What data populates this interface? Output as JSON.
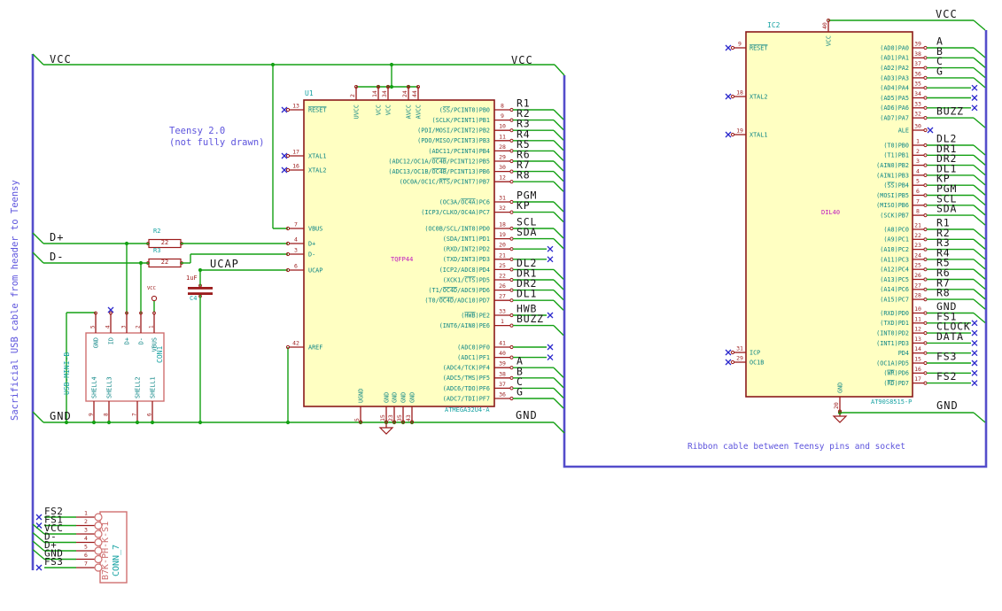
{
  "notes": {
    "left_cable": "Sacrificial USB cable from header to Teensy",
    "teensy_line1": "Teensy 2.0",
    "teensy_line2": "(not fully drawn)",
    "ribbon": "Ribbon cable between Teensy pins and socket"
  },
  "net_labels": {
    "vcc": "VCC",
    "gnd": "GND",
    "dplus": "D+",
    "dminus": "D-",
    "ucap": "UCAP"
  },
  "u1": {
    "ref": "U1",
    "package": "TQFP44",
    "value": "ATMEGA32U4-A",
    "top_pins": [
      {
        "num": "2",
        "name": "UVCC"
      },
      {
        "num": "14",
        "name": "VCC"
      },
      {
        "num": "34",
        "name": "VCC"
      },
      {
        "num": "24",
        "name": "AVCC"
      },
      {
        "num": "44",
        "name": "AVCC"
      }
    ],
    "bottom_pins": [
      {
        "num": "5",
        "name": "UGND"
      },
      {
        "num": "15",
        "name": "GND"
      },
      {
        "num": "23",
        "name": "GND"
      },
      {
        "num": "35",
        "name": "GND"
      },
      {
        "num": "43",
        "name": "GND"
      }
    ],
    "left_pins": [
      {
        "num": "13",
        "name": "*RESET*",
        "nc": true
      },
      {
        "num": "17",
        "name": "XTAL1",
        "nc": true
      },
      {
        "num": "16",
        "name": "XTAL2",
        "nc": true
      },
      {
        "num": "7",
        "name": "VBUS"
      },
      {
        "num": "4",
        "name": "D+"
      },
      {
        "num": "3",
        "name": "D-"
      },
      {
        "num": "6",
        "name": "UCAP"
      },
      {
        "num": "42",
        "name": "AREF"
      }
    ],
    "right_groups": [
      {
        "pins": [
          {
            "num": "8",
            "name": "(*SS*/PCINT0)PB0",
            "net": "R1"
          },
          {
            "num": "9",
            "name": "(SCLK/PCINT1)PB1",
            "net": "R2"
          },
          {
            "num": "10",
            "name": "(PDI/MOSI/PCINT2)PB2",
            "net": "R3"
          },
          {
            "num": "11",
            "name": "(PDO/MISO/PCINT3)PB3",
            "net": "R4"
          },
          {
            "num": "28",
            "name": "(ADC11/PCINT4)PB4",
            "net": "R5"
          },
          {
            "num": "29",
            "name": "(ADC12/OC1A/*OC4B*/PCINT12)PB5",
            "net": "R6"
          },
          {
            "num": "30",
            "name": "(ADC13/OC1B/*OC4B*/PCINT13)PB6",
            "net": "R7"
          },
          {
            "num": "12",
            "name": "(OC0A/OC1C/*RTS*/PCINT7)PB7",
            "net": "R8"
          }
        ]
      },
      {
        "pins": [
          {
            "num": "31",
            "name": "(OC3A/*OC4A*)PC6",
            "net": "PGM"
          },
          {
            "num": "32",
            "name": "(ICP3/CLKO/OC4A)PC7",
            "net": "KP"
          }
        ]
      },
      {
        "pins": [
          {
            "num": "18",
            "name": "(OC0B/SCL/INT0)PD0",
            "net": "SCL"
          },
          {
            "num": "19",
            "name": "(SDA/INT1)PD1",
            "net": "SDA"
          },
          {
            "num": "20",
            "name": "(RXD/INT2)PD2",
            "nc": true
          },
          {
            "num": "21",
            "name": "(TXD/INT3)PD3",
            "nc": true
          },
          {
            "num": "25",
            "name": "(ICP2/ADC8)PD4",
            "net": "DL2"
          },
          {
            "num": "22",
            "name": "(XCK1/*CTS*)PD5",
            "net": "DR1"
          },
          {
            "num": "26",
            "name": "(T1/*OC4D*/ADC9)PD6",
            "net": "DR2"
          },
          {
            "num": "27",
            "name": "(T0/*OC4D*/ADC10)PD7",
            "net": "DL1"
          }
        ]
      },
      {
        "pins": [
          {
            "num": "33",
            "name": "(*HWB*)PE2",
            "net": "HWB",
            "nc": true
          },
          {
            "num": "1",
            "name": "(INT6/AIN0)PE6",
            "net": "BUZZ"
          }
        ]
      },
      {
        "pins": [
          {
            "num": "41",
            "name": "(ADC0)PF0",
            "nc": true
          },
          {
            "num": "40",
            "name": "(ADC1)PF1",
            "nc": true
          },
          {
            "num": "39",
            "name": "(ADC4/TCK)PF4",
            "net": "A"
          },
          {
            "num": "38",
            "name": "(ADC5/TMS)PF5",
            "net": "B"
          },
          {
            "num": "37",
            "name": "(ADC6/TDO)PF6",
            "net": "C"
          },
          {
            "num": "36",
            "name": "(ADC7/TDI)PF7",
            "net": "G"
          }
        ]
      }
    ]
  },
  "ic2": {
    "ref": "IC2",
    "package": "DIL40",
    "value": "AT90S8515-P",
    "top_pin": {
      "num": "40",
      "name": "VCC"
    },
    "bottom_pin": {
      "num": "20",
      "name": "GND"
    },
    "left_pins": [
      {
        "num": "9",
        "name": "*RESET*",
        "nc": true
      },
      {
        "num": "18",
        "name": "XTAL2",
        "nc": true
      },
      {
        "num": "19",
        "name": "XTAL1",
        "nc": true
      },
      {
        "num": "31",
        "name": "ICP",
        "nc": true
      },
      {
        "num": "29",
        "name": "OC1B",
        "nc": true
      }
    ],
    "right_groups": [
      {
        "pins": [
          {
            "num": "39",
            "name": "(AD0)PA0",
            "net": "A"
          },
          {
            "num": "38",
            "name": "(AD1)PA1",
            "net": "B"
          },
          {
            "num": "37",
            "name": "(AD2)PA2",
            "net": "C"
          },
          {
            "num": "36",
            "name": "(AD3)PA3",
            "net": "G"
          },
          {
            "num": "35",
            "name": "(AD4)PA4",
            "nc": true
          },
          {
            "num": "34",
            "name": "(AD5)PA5",
            "nc": true
          },
          {
            "num": "33",
            "name": "(AD6)PA6",
            "nc": true
          },
          {
            "num": "32",
            "name": "(AD7)PA7",
            "net": "BUZZ"
          }
        ]
      },
      {
        "pins": [
          {
            "num": "30",
            "name": "ALE",
            "ncAtPin": true
          }
        ]
      },
      {
        "pins": [
          {
            "num": "1",
            "name": "(T0)PB0",
            "net": "DL2"
          },
          {
            "num": "2",
            "name": "(T1)PB1",
            "net": "DR1"
          },
          {
            "num": "3",
            "name": "(AIN0)PB2",
            "net": "DR2"
          },
          {
            "num": "4",
            "name": "(AIN1)PB3",
            "net": "DL1"
          },
          {
            "num": "5",
            "name": "(*SS*)PB4",
            "net": "KP"
          },
          {
            "num": "6",
            "name": "(MOSI)PB5",
            "net": "PGM"
          },
          {
            "num": "7",
            "name": "(MISO)PB6",
            "net": "SCL"
          },
          {
            "num": "8",
            "name": "(SCK)PB7",
            "net": "SDA"
          }
        ]
      },
      {
        "pins": [
          {
            "num": "21",
            "name": "(A8)PC0",
            "net": "R1"
          },
          {
            "num": "22",
            "name": "(A9)PC1",
            "net": "R2"
          },
          {
            "num": "23",
            "name": "(A10)PC2",
            "net": "R3"
          },
          {
            "num": "24",
            "name": "(A11)PC3",
            "net": "R4"
          },
          {
            "num": "25",
            "name": "(A12)PC4",
            "net": "R5"
          },
          {
            "num": "26",
            "name": "(A13)PC5",
            "net": "R6"
          },
          {
            "num": "27",
            "name": "(A14)PC6",
            "net": "R7"
          },
          {
            "num": "28",
            "name": "(A15)PC7",
            "net": "R8"
          }
        ]
      },
      {
        "pins": [
          {
            "num": "10",
            "name": "(RXD)PD0",
            "net": "GND"
          },
          {
            "num": "11",
            "name": "(TXD)PD1",
            "net": "FS1",
            "nc": true
          },
          {
            "num": "12",
            "name": "(INT0)PD2",
            "net": "CLOCK",
            "nc": true
          },
          {
            "num": "13",
            "name": "(INT1)PD3",
            "net": "DATA",
            "nc": true
          },
          {
            "num": "14",
            "name": "PD4",
            "nc": true
          },
          {
            "num": "15",
            "name": "(OC1A)PD5",
            "net": "FS3",
            "nc": true
          },
          {
            "num": "16",
            "name": "(*WR*)PD6",
            "nc": true
          },
          {
            "num": "17",
            "name": "(*RD*)PD7",
            "net": "FS2",
            "nc": true
          }
        ]
      }
    ]
  },
  "usb": {
    "ref": "CON1",
    "value": "USB-MINI-B",
    "top_pins": [
      {
        "num": "5",
        "name": "GND"
      },
      {
        "num": "4",
        "name": "ID",
        "nc": true
      },
      {
        "num": "3",
        "name": "D+"
      },
      {
        "num": "2",
        "name": "D-"
      },
      {
        "num": "1",
        "name": "VBUS"
      }
    ],
    "bottom_pins": [
      {
        "num": "9",
        "name": "SHELL4"
      },
      {
        "num": "8",
        "name": "SHELL3"
      },
      {
        "num": "7",
        "name": "SHELL2"
      },
      {
        "num": "6",
        "name": "SHELL1"
      }
    ]
  },
  "conn7": {
    "ref": "CONN_7",
    "value": "B7K-PH-K-S1",
    "pins": [
      {
        "num": "1",
        "net": "FS2",
        "nc": true
      },
      {
        "num": "2",
        "net": "FS1",
        "nc": true
      },
      {
        "num": "3",
        "net": "VCC"
      },
      {
        "num": "4",
        "net": "D-"
      },
      {
        "num": "5",
        "net": "D+"
      },
      {
        "num": "6",
        "net": "GND"
      },
      {
        "num": "7",
        "net": "FS3",
        "nc": true
      }
    ]
  },
  "r2": {
    "ref": "R2",
    "value": "22"
  },
  "r3": {
    "ref": "R3",
    "value": "22"
  },
  "c4": {
    "ref": "C4",
    "value": "1uF"
  },
  "colors": {
    "wire": "#14a014",
    "bus": "#544dcb",
    "note": "#5d54dd",
    "nc": "#2b28cc",
    "body_border": "#8a1a1a",
    "body_fill": "#ffffc2",
    "pin": "#9b1b1b",
    "pin_name": "#0e8686",
    "ref": "#16a2a2",
    "package": "#c017c0",
    "label": "#161616",
    "connector_border": "#cf7070"
  }
}
